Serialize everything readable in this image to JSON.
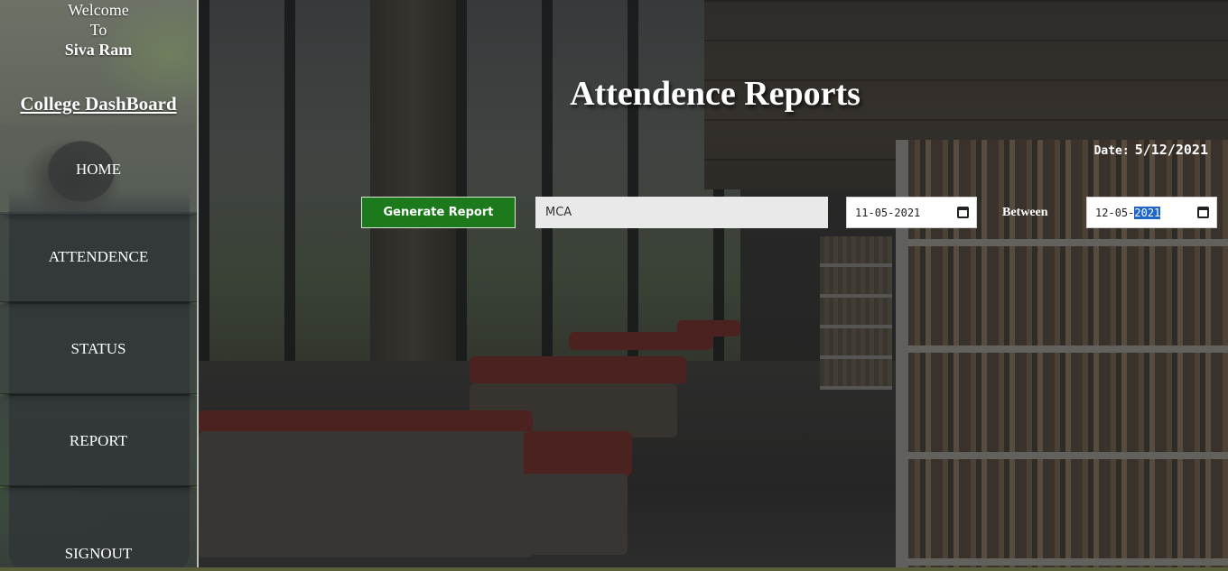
{
  "sidebar": {
    "welcome_line1": "Welcome",
    "welcome_line2": "To",
    "user_name": "Siva Ram",
    "dashboard_title": "College DashBoard",
    "items": [
      {
        "label": "HOME"
      },
      {
        "label": "ATTENDENCE"
      },
      {
        "label": "STATUS"
      },
      {
        "label": "REPORT"
      },
      {
        "label": "SIGNOUT"
      }
    ]
  },
  "main": {
    "title": "Attendence Reports",
    "date_label": "Date:",
    "date_value": "5/12/2021",
    "generate_button": "Generate Report",
    "department_value": "MCA",
    "from_date": {
      "day": "11",
      "month": "05",
      "year": "2021"
    },
    "between_label": "Between",
    "to_date": {
      "day": "12",
      "month": "05",
      "year": "2021"
    }
  },
  "colors": {
    "generate_button": "#1c7a1c",
    "year_highlight": "#1f66c8",
    "sidebar_border": "#b9bdb6"
  }
}
